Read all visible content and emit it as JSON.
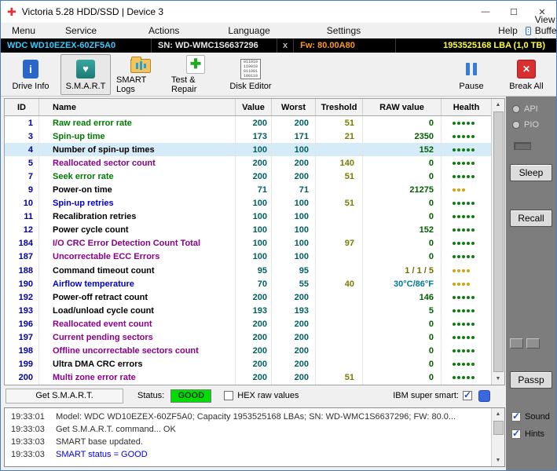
{
  "window": {
    "title": "Victoria 5.28 HDD/SSD | Device 3"
  },
  "menu": {
    "items": [
      "Menu",
      "Service",
      "Actions",
      "Language",
      "Settings",
      "Help"
    ],
    "view_buffer_label": "View Buffer Live"
  },
  "device_bar": {
    "model": "WDC WD10EZEX-60ZF5A0",
    "serial": "SN: WD-WMC1S6637296",
    "x_label": "x",
    "firmware": "Fw: 80.00A80",
    "capacity": "1953525168 LBA (1,0 TB)"
  },
  "toolbar": {
    "items": [
      "Drive Info",
      "S.M.A.R.T",
      "SMART Logs",
      "Test & Repair",
      "Disk Editor"
    ],
    "pause_label": "Pause",
    "break_all_label": "Break All"
  },
  "smart_table": {
    "headers": [
      "ID",
      "Name",
      "Value",
      "Worst",
      "Treshold",
      "RAW value",
      "Health"
    ],
    "rows": [
      {
        "id": 1,
        "name": "Raw read error rate",
        "name_color": "#007a00",
        "value": 200,
        "worst": 200,
        "treshold": "51",
        "raw": "0",
        "raw_color": "#005f00",
        "health": {
          "dots": 5,
          "color": "#0e7d0e"
        }
      },
      {
        "id": 3,
        "name": "Spin-up time",
        "name_color": "#007a00",
        "value": 173,
        "worst": 171,
        "treshold": "21",
        "raw": "2350",
        "raw_color": "#005f00",
        "health": {
          "dots": 5,
          "color": "#0e7d0e"
        }
      },
      {
        "id": 4,
        "name": "Number of spin-up times",
        "name_color": "#000000",
        "value": 100,
        "worst": 100,
        "treshold": "",
        "raw": "152",
        "raw_color": "#005f00",
        "health": {
          "dots": 5,
          "color": "#0e7d0e"
        },
        "selected": true
      },
      {
        "id": 5,
        "name": "Reallocated sector count",
        "name_color": "#8a008a",
        "value": 200,
        "worst": 200,
        "treshold": "140",
        "raw": "0",
        "raw_color": "#005f00",
        "health": {
          "dots": 5,
          "color": "#0e7d0e"
        }
      },
      {
        "id": 7,
        "name": "Seek error rate",
        "name_color": "#007a00",
        "value": 200,
        "worst": 200,
        "treshold": "51",
        "raw": "0",
        "raw_color": "#005f00",
        "health": {
          "dots": 5,
          "color": "#0e7d0e"
        }
      },
      {
        "id": 9,
        "name": "Power-on time",
        "name_color": "#000000",
        "value": 71,
        "worst": 71,
        "treshold": "",
        "raw": "21275",
        "raw_color": "#005f00",
        "health": {
          "dots": 3,
          "color": "#d0a312"
        }
      },
      {
        "id": 10,
        "name": "Spin-up retries",
        "name_color": "#0000cc",
        "value": 100,
        "worst": 100,
        "treshold": "51",
        "raw": "0",
        "raw_color": "#005f00",
        "health": {
          "dots": 5,
          "color": "#0e7d0e"
        }
      },
      {
        "id": 11,
        "name": "Recalibration retries",
        "name_color": "#000000",
        "value": 100,
        "worst": 100,
        "treshold": "",
        "raw": "0",
        "raw_color": "#005f00",
        "health": {
          "dots": 5,
          "color": "#0e7d0e"
        }
      },
      {
        "id": 12,
        "name": "Power cycle count",
        "name_color": "#000000",
        "value": 100,
        "worst": 100,
        "treshold": "",
        "raw": "152",
        "raw_color": "#005f00",
        "health": {
          "dots": 5,
          "color": "#0e7d0e"
        }
      },
      {
        "id": 184,
        "name": "I/O CRC Error Detection Count Total",
        "name_color": "#8a008a",
        "value": 100,
        "worst": 100,
        "treshold": "97",
        "raw": "0",
        "raw_color": "#005f00",
        "health": {
          "dots": 5,
          "color": "#0e7d0e"
        }
      },
      {
        "id": 187,
        "name": "Uncorrectable ECC Errors",
        "name_color": "#8a008a",
        "value": 100,
        "worst": 100,
        "treshold": "",
        "raw": "0",
        "raw_color": "#005f00",
        "health": {
          "dots": 5,
          "color": "#0e7d0e"
        }
      },
      {
        "id": 188,
        "name": "Command timeout count",
        "name_color": "#000000",
        "value": 95,
        "worst": 95,
        "treshold": "",
        "raw": "1 / 1 / 5",
        "raw_color": "#6e6e00",
        "health": {
          "dots": 4,
          "color": "#d0a312"
        }
      },
      {
        "id": 190,
        "name": "Airflow temperature",
        "name_color": "#0000cc",
        "value": 70,
        "worst": 55,
        "treshold": "40",
        "raw": "30°C/86°F",
        "raw_color": "#00789a",
        "health": {
          "dots": 4,
          "color": "#d0a312"
        }
      },
      {
        "id": 192,
        "name": "Power-off retract count",
        "name_color": "#000000",
        "value": 200,
        "worst": 200,
        "treshold": "",
        "raw": "146",
        "raw_color": "#005f00",
        "health": {
          "dots": 5,
          "color": "#0e7d0e"
        }
      },
      {
        "id": 193,
        "name": "Load/unload cycle count",
        "name_color": "#000000",
        "value": 193,
        "worst": 193,
        "treshold": "",
        "raw": "5",
        "raw_color": "#005f00",
        "health": {
          "dots": 5,
          "color": "#0e7d0e"
        }
      },
      {
        "id": 196,
        "name": "Reallocated event count",
        "name_color": "#8a008a",
        "value": 200,
        "worst": 200,
        "treshold": "",
        "raw": "0",
        "raw_color": "#005f00",
        "health": {
          "dots": 5,
          "color": "#0e7d0e"
        }
      },
      {
        "id": 197,
        "name": "Current pending sectors",
        "name_color": "#8a008a",
        "value": 200,
        "worst": 200,
        "treshold": "",
        "raw": "0",
        "raw_color": "#005f00",
        "health": {
          "dots": 5,
          "color": "#0e7d0e"
        }
      },
      {
        "id": 198,
        "name": "Offline uncorrectable sectors count",
        "name_color": "#8a008a",
        "value": 200,
        "worst": 200,
        "treshold": "",
        "raw": "0",
        "raw_color": "#005f00",
        "health": {
          "dots": 5,
          "color": "#0e7d0e"
        }
      },
      {
        "id": 199,
        "name": "Ultra DMA CRC errors",
        "name_color": "#000000",
        "value": 200,
        "worst": 200,
        "treshold": "",
        "raw": "0",
        "raw_color": "#005f00",
        "health": {
          "dots": 5,
          "color": "#0e7d0e"
        }
      },
      {
        "id": 200,
        "name": "Multi zone error rate",
        "name_color": "#8a008a",
        "value": 200,
        "worst": 200,
        "treshold": "51",
        "raw": "0",
        "raw_color": "#005f00",
        "health": {
          "dots": 5,
          "color": "#0e7d0e"
        }
      }
    ]
  },
  "status_bar": {
    "get_smart_label": "Get S.M.A.R.T.",
    "status_label": "Status:",
    "status_value": "GOOD",
    "status_color": "#00dd00",
    "hex_label": "HEX raw values",
    "ibm_label": "IBM super smart:"
  },
  "log": {
    "lines": [
      {
        "time": "19:33:01",
        "text": "Model: WDC WD10EZEX-60ZF5A0; Capacity 1953525168 LBAs; SN: WD-WMC1S6637296; FW: 80.0...",
        "color": "#303030"
      },
      {
        "time": "19:33:03",
        "text": "Get S.M.A.R.T. command... OK",
        "color": "#303030"
      },
      {
        "time": "19:33:03",
        "text": "SMART base updated.",
        "color": "#303030"
      },
      {
        "time": "19:33:03",
        "text": "SMART status = GOOD",
        "color": "#0000dd"
      }
    ]
  },
  "right_panel": {
    "api_label": "API",
    "pio_label": "PIO",
    "sleep_label": "Sleep",
    "recall_label": "Recall",
    "passp_label": "Passp",
    "sound_label": "Sound",
    "hints_label": "Hints"
  }
}
